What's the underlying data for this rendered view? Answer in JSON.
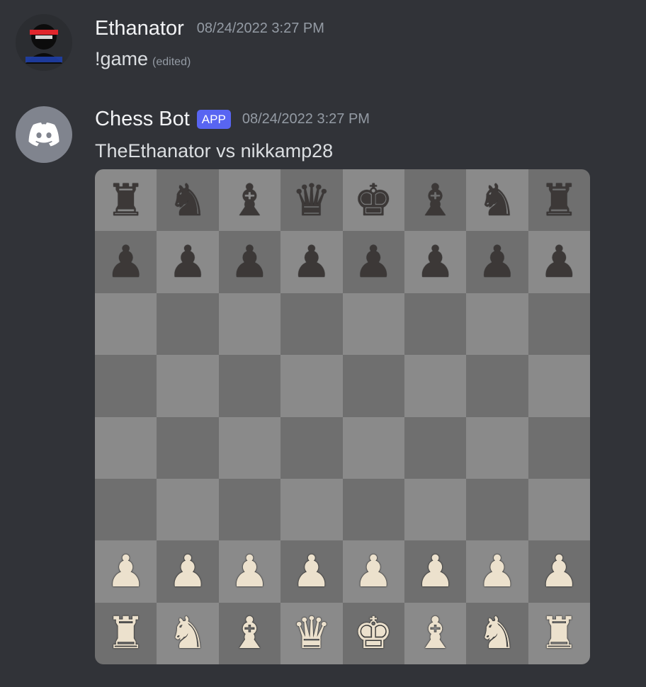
{
  "messages": [
    {
      "author": "Ethanator",
      "timestamp": "08/24/2022 3:27 PM",
      "content": "!game",
      "edited_label": "(edited)",
      "avatar_icon": "ninja-avatar-icon"
    },
    {
      "author": "Chess Bot",
      "tag": "APP",
      "timestamp": "08/24/2022 3:27 PM",
      "content": "TheEthanator vs nikkamp28",
      "avatar_icon": "discord-logo-icon"
    }
  ],
  "board": {
    "rows": [
      [
        "r",
        "n",
        "b",
        "q",
        "k",
        "b",
        "n",
        "r"
      ],
      [
        "p",
        "p",
        "p",
        "p",
        "p",
        "p",
        "p",
        "p"
      ],
      [
        "",
        "",
        "",
        "",
        "",
        "",
        "",
        ""
      ],
      [
        "",
        "",
        "",
        "",
        "",
        "",
        "",
        ""
      ],
      [
        "",
        "",
        "",
        "",
        "",
        "",
        "",
        ""
      ],
      [
        "",
        "",
        "",
        "",
        "",
        "",
        "",
        ""
      ],
      [
        "P",
        "P",
        "P",
        "P",
        "P",
        "P",
        "P",
        "P"
      ],
      [
        "R",
        "N",
        "B",
        "Q",
        "K",
        "B",
        "N",
        "R"
      ]
    ],
    "colors": {
      "light": "#8a8a8a",
      "dark": "#6f6f6f",
      "black_piece": "#3c3837",
      "white_piece": "#ece1cd"
    }
  },
  "theme": {
    "background": "#313338",
    "app_tag": "#5865f2"
  }
}
